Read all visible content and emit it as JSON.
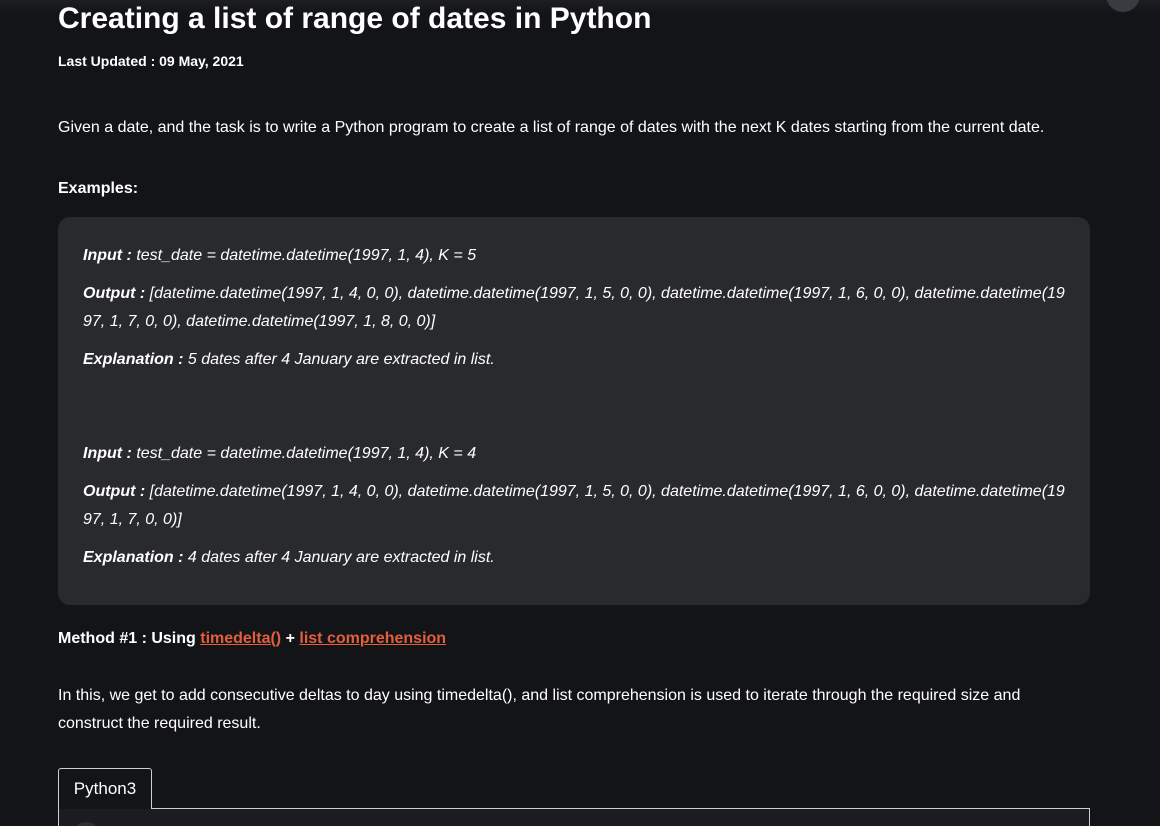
{
  "article": {
    "title": "Creating a list of range of dates in Python",
    "last_updated": "Last Updated : 09 May, 2021",
    "intro": "Given a date, and the task is to write a Python program to create a list of range of dates with the next K dates starting from the current date.",
    "examples_heading": "Examples:"
  },
  "examples": [
    {
      "input_label": "Input :",
      "input_value": " test_date = datetime.datetime(1997, 1, 4), K = 5",
      "output_label": "Output :",
      "output_value": " [datetime.datetime(1997, 1, 4, 0, 0), datetime.datetime(1997, 1, 5, 0, 0), datetime.datetime(1997, 1, 6, 0, 0), datetime.datetime(1997, 1, 7, 0, 0), datetime.datetime(1997, 1, 8, 0, 0)]",
      "explanation_label": "Explanation :",
      "explanation_value": " 5 dates after 4 January are extracted in list."
    },
    {
      "input_label": "Input :",
      "input_value": " test_date = datetime.datetime(1997, 1, 4), K = 4",
      "output_label": "Output :",
      "output_value": " [datetime.datetime(1997, 1, 4, 0, 0), datetime.datetime(1997, 1, 5, 0, 0), datetime.datetime(1997, 1, 6, 0, 0), datetime.datetime(1997, 1, 7, 0, 0)]",
      "explanation_label": "Explanation :",
      "explanation_value": " 4 dates after 4 January are extracted in list."
    }
  ],
  "method": {
    "prefix": "Method #1 : Using ",
    "link1": "timedelta()",
    "joiner": " + ",
    "link2": "list comprehension",
    "description": "In this, we get to add consecutive deltas to day using timedelta(), and list comprehension is used to iterate through the required size and construct the required result."
  },
  "code_tabs": {
    "active_tab": "Python3"
  },
  "colors": {
    "background": "#131417",
    "example_box": "#292a2d",
    "link": "#e35f3c",
    "text": "#ffffff"
  }
}
